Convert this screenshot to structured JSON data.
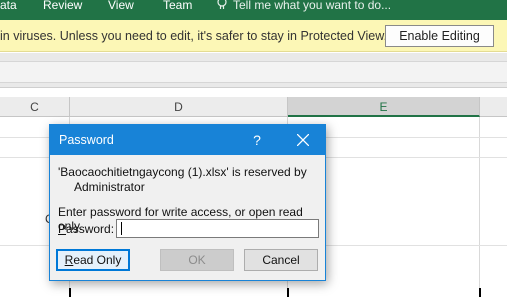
{
  "ribbon": {
    "tabs": [
      "ata",
      "Review",
      "View",
      "Team"
    ],
    "tell_me": "Tell me what you want to do...",
    "tell_me_icon": "lightbulb-icon",
    "background_color": "#217346"
  },
  "protected_view": {
    "message": "in viruses. Unless you need to edit, it's safer to stay in Protected View.",
    "enable_editing_label": "Enable Editing",
    "background_color": "#fcf7b6"
  },
  "sheet": {
    "columns": [
      "C",
      "D",
      "E"
    ],
    "selected_column": "E",
    "stray_text": "C"
  },
  "dialog": {
    "title": "Password",
    "help_label": "?",
    "close_icon": "close-icon",
    "reserved_line1": "'Baocaochitietngaycong (1).xlsx' is reserved by",
    "reserved_line2": "Administrator",
    "instruction": "Enter password for write access, or open read only.",
    "password_label_accel": "P",
    "password_label_rest": "assword:",
    "password_value": "",
    "buttons": {
      "read_only_accel": "R",
      "read_only_rest": "ead Only",
      "ok": "OK",
      "cancel": "Cancel"
    },
    "accent_color": "#1883d7"
  }
}
